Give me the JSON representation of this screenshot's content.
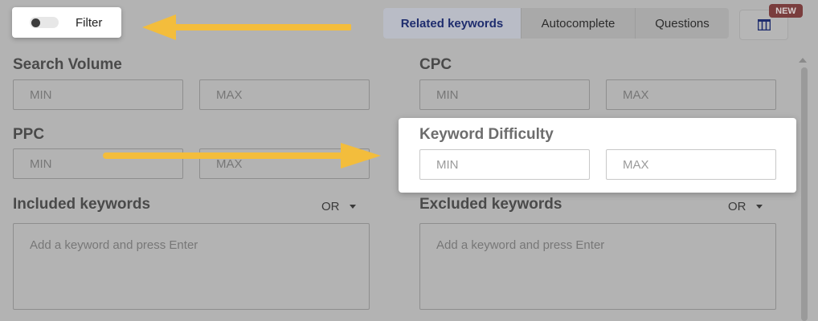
{
  "filter": {
    "label": "Filter"
  },
  "tabs": [
    {
      "label": "Related keywords",
      "active": true
    },
    {
      "label": "Autocomplete",
      "active": false
    },
    {
      "label": "Questions",
      "active": false
    }
  ],
  "columns_button": {
    "icon": "columns-icon",
    "badge": "NEW"
  },
  "fields": {
    "search_volume": {
      "label": "Search Volume",
      "min_placeholder": "MIN",
      "max_placeholder": "MAX"
    },
    "cpc": {
      "label": "CPC",
      "min_placeholder": "MIN",
      "max_placeholder": "MAX"
    },
    "ppc": {
      "label": "PPC",
      "min_placeholder": "MIN",
      "max_placeholder": "MAX"
    },
    "keyword_difficulty": {
      "label": "Keyword Difficulty",
      "min_placeholder": "MIN",
      "max_placeholder": "MAX"
    },
    "included_keywords": {
      "label": "Included keywords",
      "operator": "OR",
      "placeholder": "Add a keyword and press Enter"
    },
    "excluded_keywords": {
      "label": "Excluded keywords",
      "operator": "OR",
      "placeholder": "Add a keyword and press Enter"
    }
  },
  "annotations": {
    "arrow_color": "#f3bd3c"
  },
  "colors": {
    "active_tab_text": "#1f2d6e",
    "badge_bg": "#7a3d3d"
  }
}
